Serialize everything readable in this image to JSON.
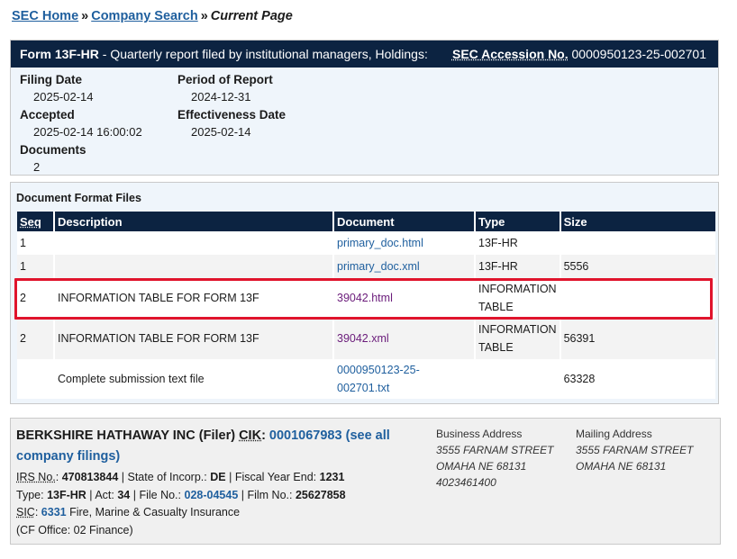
{
  "breadcrumb": {
    "home": "SEC Home",
    "company_search": "Company Search",
    "separator": "»",
    "current": "Current Page"
  },
  "form": {
    "type": "Form 13F-HR",
    "description": " - Quarterly report filed by institutional managers, Holdings:",
    "accession_label": "SEC Accession No.",
    "accession_number": "0000950123-25-002701",
    "filing_date_label": "Filing Date",
    "filing_date": "2025-02-14",
    "accepted_label": "Accepted",
    "accepted": "2025-02-14 16:00:02",
    "documents_label": "Documents",
    "documents": "2",
    "period_label": "Period of Report",
    "period": "2024-12-31",
    "effectiveness_label": "Effectiveness Date",
    "effectiveness": "2025-02-14"
  },
  "files": {
    "title": "Document Format Files",
    "headers": [
      "Seq",
      "Description",
      "Document",
      "Type",
      "Size"
    ],
    "rows": [
      {
        "seq": "1",
        "description": "",
        "document": "primary_doc.html",
        "type": "13F-HR",
        "size": ""
      },
      {
        "seq": "1",
        "description": "",
        "document": "primary_doc.xml",
        "type": "13F-HR",
        "size": "5556"
      },
      {
        "seq": "2",
        "description": "INFORMATION TABLE FOR FORM 13F",
        "document": "39042.html",
        "type": "INFORMATION TABLE",
        "size": ""
      },
      {
        "seq": "2",
        "description": "INFORMATION TABLE FOR FORM 13F",
        "document": "39042.xml",
        "type": "INFORMATION TABLE",
        "size": "56391"
      },
      {
        "seq": "",
        "description": "Complete submission text file",
        "document": "0000950123-25-002701.txt",
        "type": "",
        "size": "63328"
      }
    ],
    "highlight_color": "#e0142c"
  },
  "filer": {
    "name": "BERKSHIRE HATHAWAY INC (Filer)",
    "cik_label": "CIK",
    "cik": "0001067983",
    "see_all": "(see all company filings)",
    "irs_label": "IRS No.",
    "irs": "470813844",
    "state_label": "State of Incorp.",
    "state": "DE",
    "fye_label": "Fiscal Year End",
    "fye": "1231",
    "type_label": "Type",
    "type": "13F-HR",
    "act_label": "Act",
    "act": "34",
    "file_label": "File No.",
    "file": "028-04545",
    "film_label": "Film No.",
    "film": "25627858",
    "sic_label": "SIC",
    "sic": "6331",
    "sic_desc": "Fire, Marine & Casualty Insurance",
    "office": "(CF Office: 02 Finance)",
    "business_title": "Business Address",
    "business_street": "3555 FARNAM STREET",
    "business_city": "OMAHA NE 68131",
    "business_phone": "4023461400",
    "mailing_title": "Mailing Address",
    "mailing_street": "3555 FARNAM STREET",
    "mailing_city": "OMAHA NE 68131"
  }
}
